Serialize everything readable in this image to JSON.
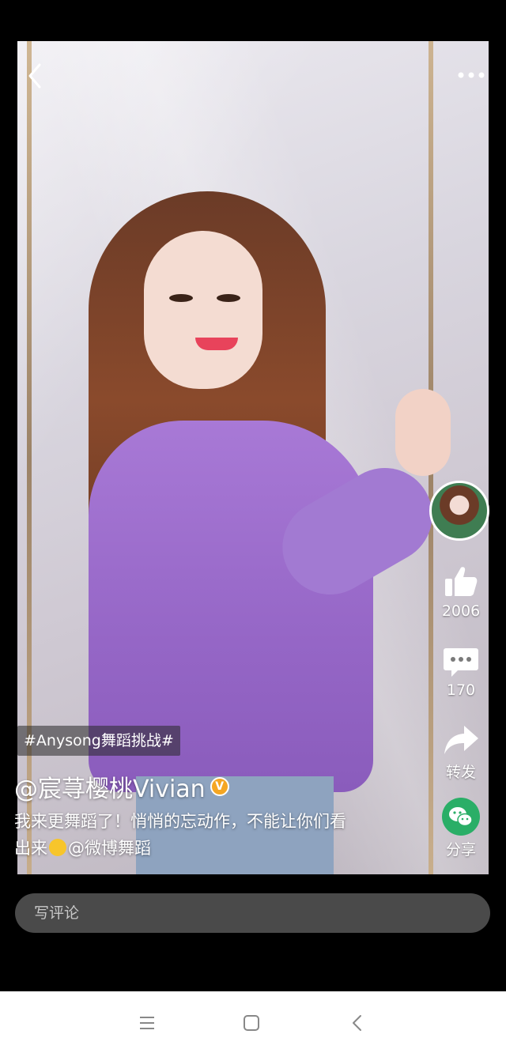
{
  "video": {
    "hashtag": "#Anysong舞蹈挑战#",
    "author_name": "@宸荨樱桃Vivian",
    "caption_line1": "我来更舞蹈了！悄悄的忘动作，不能让你们看",
    "caption_line2_pre": "出来",
    "caption_mention": "@微博舞蹈"
  },
  "actions": {
    "like_count": "2006",
    "comment_count": "170",
    "repost_label": "转发",
    "share_label": "分享"
  },
  "comment": {
    "placeholder": "写评论"
  },
  "icons": {
    "back": "chevron-left-icon",
    "more": "ellipsis-icon",
    "like": "thumbs-up-icon",
    "comment": "speech-bubble-icon",
    "repost": "forward-arrow-icon",
    "share": "wechat-icon",
    "verified": "verified-badge-icon",
    "nav_menu": "menu-icon",
    "nav_home": "home-square-icon",
    "nav_back": "back-chevron-icon"
  },
  "colors": {
    "wechat_green": "#2aae67",
    "verified_orange": "#f5a623",
    "comment_bar": "#4a4a4a"
  }
}
